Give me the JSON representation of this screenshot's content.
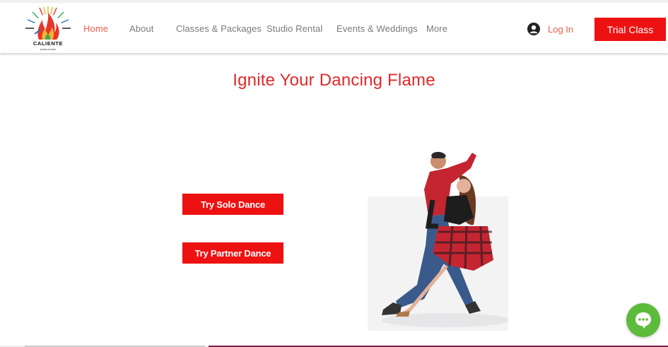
{
  "brand": {
    "logo_text": "CALIENTE",
    "logo_subtext": "DANCE STUDIO",
    "logo_icon": "flame-logo-icon"
  },
  "nav": {
    "items": [
      {
        "label": "Home",
        "active": true
      },
      {
        "label": "About",
        "active": false
      },
      {
        "label": "Classes & Packages",
        "active": false
      },
      {
        "label": "Studio Rental",
        "active": false
      },
      {
        "label": "Events & Weddings",
        "active": false
      },
      {
        "label": "More",
        "active": false
      }
    ]
  },
  "auth": {
    "login_label": "Log In",
    "login_icon": "user-avatar-icon"
  },
  "header_cta": {
    "label": "Trial Class"
  },
  "hero": {
    "title": "Ignite Your Dancing Flame",
    "solo_label": "Try Solo Dance",
    "partner_label": "Try Partner Dance",
    "photo_icon": "dancing-couple-photo"
  },
  "chat": {
    "icon": "chat-bubble-icon"
  },
  "colors": {
    "accent": "#ee1111",
    "title": "#e0292a",
    "nav_active": "#ee5b4a",
    "nav_text": "#7a7a7a",
    "chat": "#5dbb3b"
  }
}
